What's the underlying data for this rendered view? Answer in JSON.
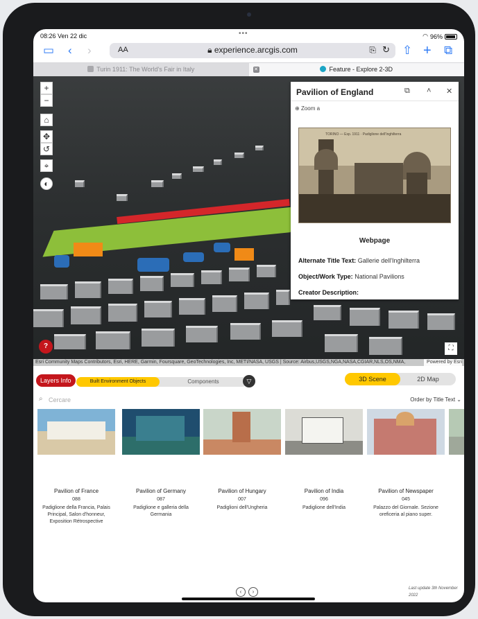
{
  "status": {
    "time": "08:26",
    "date": "Ven 22 dic",
    "battery": "96%"
  },
  "browser": {
    "text_size": "AA",
    "url": "experience.arcgis.com",
    "tabs": [
      {
        "label": "Turin 1911: The World's Fair in Italy",
        "active": false
      },
      {
        "label": "Feature - Explore 2-3D",
        "active": true
      }
    ]
  },
  "map": {
    "zoom_in": "+",
    "zoom_out": "−",
    "help": "?",
    "attribution": "Esri Community Maps Contributors, Esri, HERE, Garmin, Foursquare, GeoTechnologies, Inc, METI/NASA, USGS | Source: Airbus,USGS,NGA,NASA,CGIAR,NLS,OS,NMA,",
    "powered_by": "Powered by Esri"
  },
  "popup": {
    "title": "Pavilion of England",
    "zoom": "Zoom a",
    "photo_caption": "TORINO — Esp. 1911 · Padiglione dell'Inghilterra",
    "webpage": "Webpage",
    "fields": [
      {
        "label": "Alternate Title Text:",
        "value": "Gallerie dell'Inghilterra"
      },
      {
        "label": "Object/Work Type:",
        "value": "National Pavilions"
      },
      {
        "label": "Creator Description:",
        "value": ""
      }
    ]
  },
  "panel": {
    "layers_info": "Layers Info",
    "tab_built": "Built Environment Objects",
    "tab_components": "Components",
    "view_3d": "3D Scene",
    "view_2d": "2D Map",
    "search_placeholder": "Cercare",
    "order_by": "Order by Title Text ⌄",
    "last_update": "Last update 3th November 2022"
  },
  "cards": [
    {
      "name": "Pavilion of France",
      "code": "088",
      "desc": "Padiglione della Francia, Palais Principal, Salon d'honneur, Exposition Rétrospective",
      "sky": "#7fb3d6",
      "ground": "#d9c9a7"
    },
    {
      "name": "Pavilion of Germany",
      "code": "087",
      "desc": "Padiglione e galleria della Germania",
      "sky": "#1f4d6e",
      "ground": "#2d6e6a"
    },
    {
      "name": "Pavilion of Hungary",
      "code": "007",
      "desc": "Padiglioni dell'Ungheria",
      "sky": "#c9d6c9",
      "ground": "#c98863"
    },
    {
      "name": "Pavilion of India",
      "code": "096",
      "desc": "Padiglione dell'India",
      "sky": "#dcdcd6",
      "ground": "#8c8c86"
    },
    {
      "name": "Pavilion of Newspaper",
      "code": "045",
      "desc": "Palazzo del Giornale. Sezione oreficeria al piano super.",
      "sky": "#cfd9e3",
      "ground": "#c57a70"
    },
    {
      "name": "",
      "code": "",
      "desc": "",
      "sky": "#b6c9b4",
      "ground": "#9fa89a"
    }
  ]
}
